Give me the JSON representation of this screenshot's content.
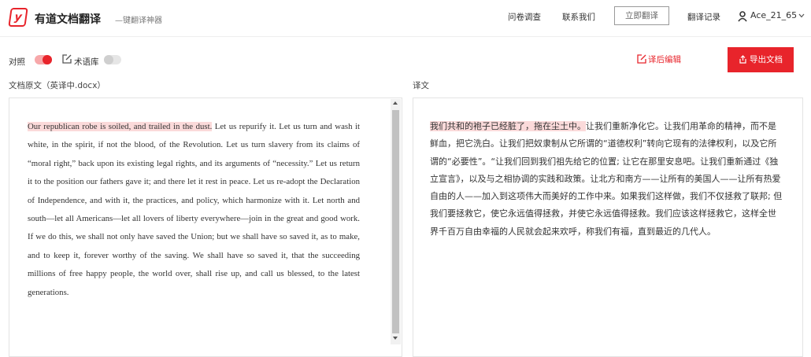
{
  "header": {
    "logo_glyph": "y",
    "brand_title": "有道文档翻译",
    "brand_sub": "—键翻译神器",
    "nav": {
      "survey": "问卷调查",
      "contact": "联系我们",
      "translate_now": "立即翻译",
      "history": "翻译记录"
    },
    "user": {
      "name": "Ace_21_65"
    }
  },
  "toolbar": {
    "compare_label": "对照",
    "compare_on": true,
    "termbase_label": "术语库",
    "termbase_on": false,
    "post_edit_label": "译后编辑",
    "export_label": "导出文档"
  },
  "colors": {
    "accent": "#e8242b",
    "highlight": "#fbdada"
  },
  "source": {
    "label": "文档原文（英译中.docx）",
    "highlighted": "Our republican robe is soiled, and trailed in the dust.",
    "rest": " Let us repurify it. Let us turn and wash it white, in the spirit, if not the blood, of the Revolution. Let us turn slavery from its claims of “moral right,” back upon its existing legal rights, and its arguments of “necessity.” Let us return it to the position our fathers gave it; and there let it rest in peace. Let us re-adopt the Declaration of Independence, and with it, the practices, and policy, which harmonize with it. Let north and south—let all Americans—let all lovers of liberty everywhere—join in the great and good work. If we do this, we shall not only have saved the Union; but we shall have so saved it, as to make, and to keep it, forever worthy of the saving. We shall have so saved it, that the succeeding millions of free happy people, the world over, shall rise up, and call us blessed, to the latest generations."
  },
  "target": {
    "label": "译文",
    "highlighted": "我们共和的袍子已经脏了，拖在尘土中。",
    "rest": "让我们重新净化它。让我们用革命的精神，而不是鲜血，把它洗白。让我们把奴隶制从它所谓的“道德权利”转向它现有的法律权利，以及它所谓的“必要性”。“让我们回到我们祖先给它的位置; 让它在那里安息吧。让我们重新通过《独立宣言》，以及与之相协调的实践和政策。让北方和南方——让所有的美国人——让所有热爱自由的人——加入到这项伟大而美好的工作中来。如果我们这样做，我们不仅拯救了联邦; 但我们要拯救它，使它永远值得拯救，并使它永远值得拯救。我们应该这样拯救它，这样全世界千百万自由幸福的人民就会起来欢呼，称我们有福，直到最近的几代人。"
  }
}
